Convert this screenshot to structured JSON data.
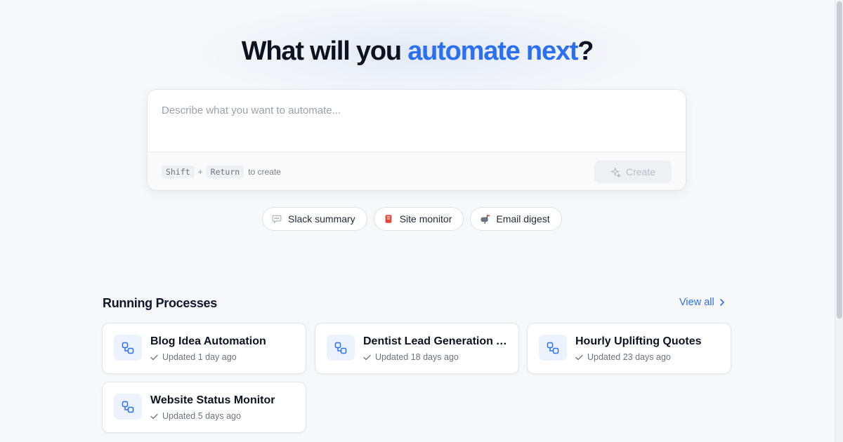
{
  "hero": {
    "title_part1": "What will you ",
    "title_accent": "automate next",
    "title_end": "?"
  },
  "prompt": {
    "placeholder": "Describe what you want to automate...",
    "value": "",
    "key1": "Shift",
    "plus": "+",
    "key2": "Return",
    "hint": "to create",
    "create_label": "Create"
  },
  "suggestions": [
    {
      "label": "Slack summary",
      "icon": "speech-bubble-icon"
    },
    {
      "label": "Site monitor",
      "icon": "red-badge-icon"
    },
    {
      "label": "Email digest",
      "icon": "mailbox-icon"
    }
  ],
  "processes": {
    "title": "Running Processes",
    "view_all": "View all",
    "items": [
      {
        "title": "Blog Idea Automation",
        "updated": "Updated 1 day ago"
      },
      {
        "title": "Dentist Lead Generation Automation",
        "updated": "Updated 18 days ago"
      },
      {
        "title": "Hourly Uplifting Quotes",
        "updated": "Updated 23 days ago"
      },
      {
        "title": "Website Status Monitor",
        "updated": "Updated 5 days ago"
      }
    ]
  },
  "colors": {
    "accent": "#2b6ff2",
    "heading": "#0b1220",
    "background": "#f7f8fb"
  }
}
